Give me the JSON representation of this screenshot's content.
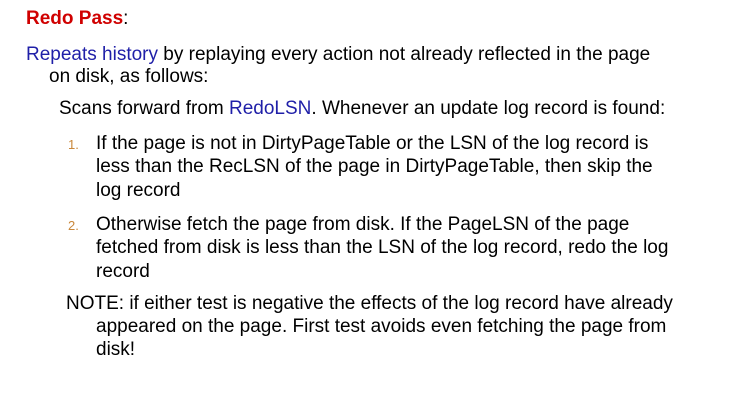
{
  "heading": {
    "title": "Redo Pass",
    "colon": ":"
  },
  "intro": {
    "highlight": "Repeats history",
    "rest_line1": " by replaying every action not already reflected in the page",
    "line2": "on disk, as follows:"
  },
  "scan": {
    "prefix": "Scans forward from ",
    "highlight": "RedoLSN",
    "suffix": ".  Whenever an update log record is found:"
  },
  "steps": [
    {
      "number": "1.",
      "lines": [
        "If the page is not in DirtyPageTable or the LSN of the log record is",
        "less than the RecLSN of the page in DirtyPageTable, then skip the",
        "log record"
      ]
    },
    {
      "number": "2.",
      "lines": [
        "Otherwise fetch the page from disk.  If the PageLSN of the page",
        "fetched from disk is less than the LSN of the log record, redo the log",
        "record"
      ]
    }
  ],
  "note": {
    "lines": [
      "NOTE: if either test is negative the effects of the log record have already",
      "appeared on the page.  First test avoids even fetching the page from",
      "disk!"
    ]
  },
  "colors": {
    "heading": "#d00000",
    "highlight": "#1f1fa8",
    "numbering": "#c9873a",
    "text": "#000000"
  }
}
